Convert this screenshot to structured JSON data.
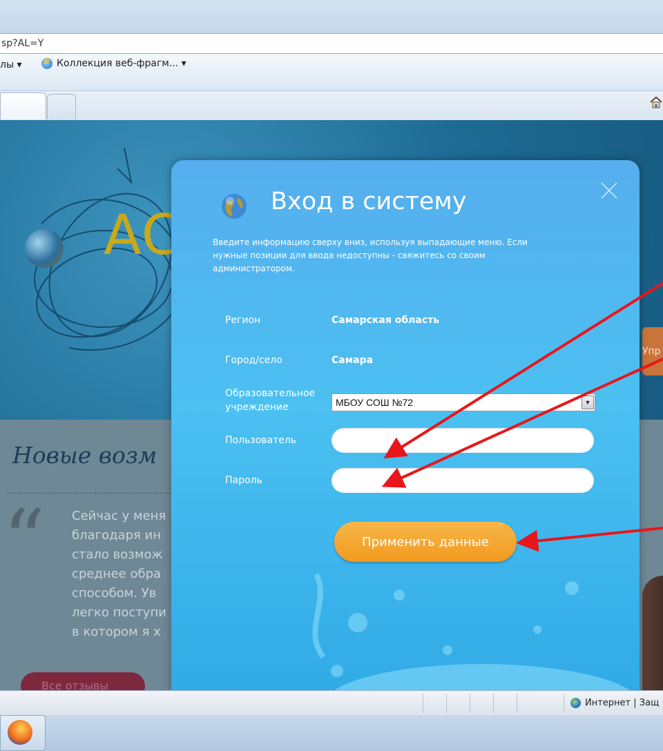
{
  "browser": {
    "address_text": "sp?AL=Y",
    "favorites_item": "лы ▾",
    "favorites_link": "Коллекция веб-фрагм... ▾"
  },
  "page": {
    "logo_text": "АС",
    "side_tab": "Упр",
    "headline": "Новые возм",
    "quote_mark": "“",
    "quote_lines": [
      "Сейчас у меня",
      "благодаря ин",
      "стало возмож",
      "среднее обра",
      "способом. Ув",
      "легко поступи",
      "в котором я х"
    ],
    "pill_text": "Все отзывы"
  },
  "modal": {
    "title": "Вход в систему",
    "description": "Введите информацию сверху вниз, используя выпадающие меню. Если нужные позиции для ввода недоступны - свяжитесь со своим администратором.",
    "region_label": "Регион",
    "region_value": "Самарская область",
    "city_label": "Город/село",
    "city_value": "Самара",
    "school_label_1": "Образовательное",
    "school_label_2": "учреждение",
    "school_value": "МБОУ СОШ №72",
    "user_label": "Пользователь",
    "user_value": "",
    "password_label": "Пароль",
    "password_value": "",
    "apply_label": "Применить данные"
  },
  "status": {
    "zone_text": "Интернет | Защ"
  },
  "colors": {
    "modal_top": "#56aeee",
    "button": "#f4a22b",
    "arrow": "#e8161b"
  }
}
